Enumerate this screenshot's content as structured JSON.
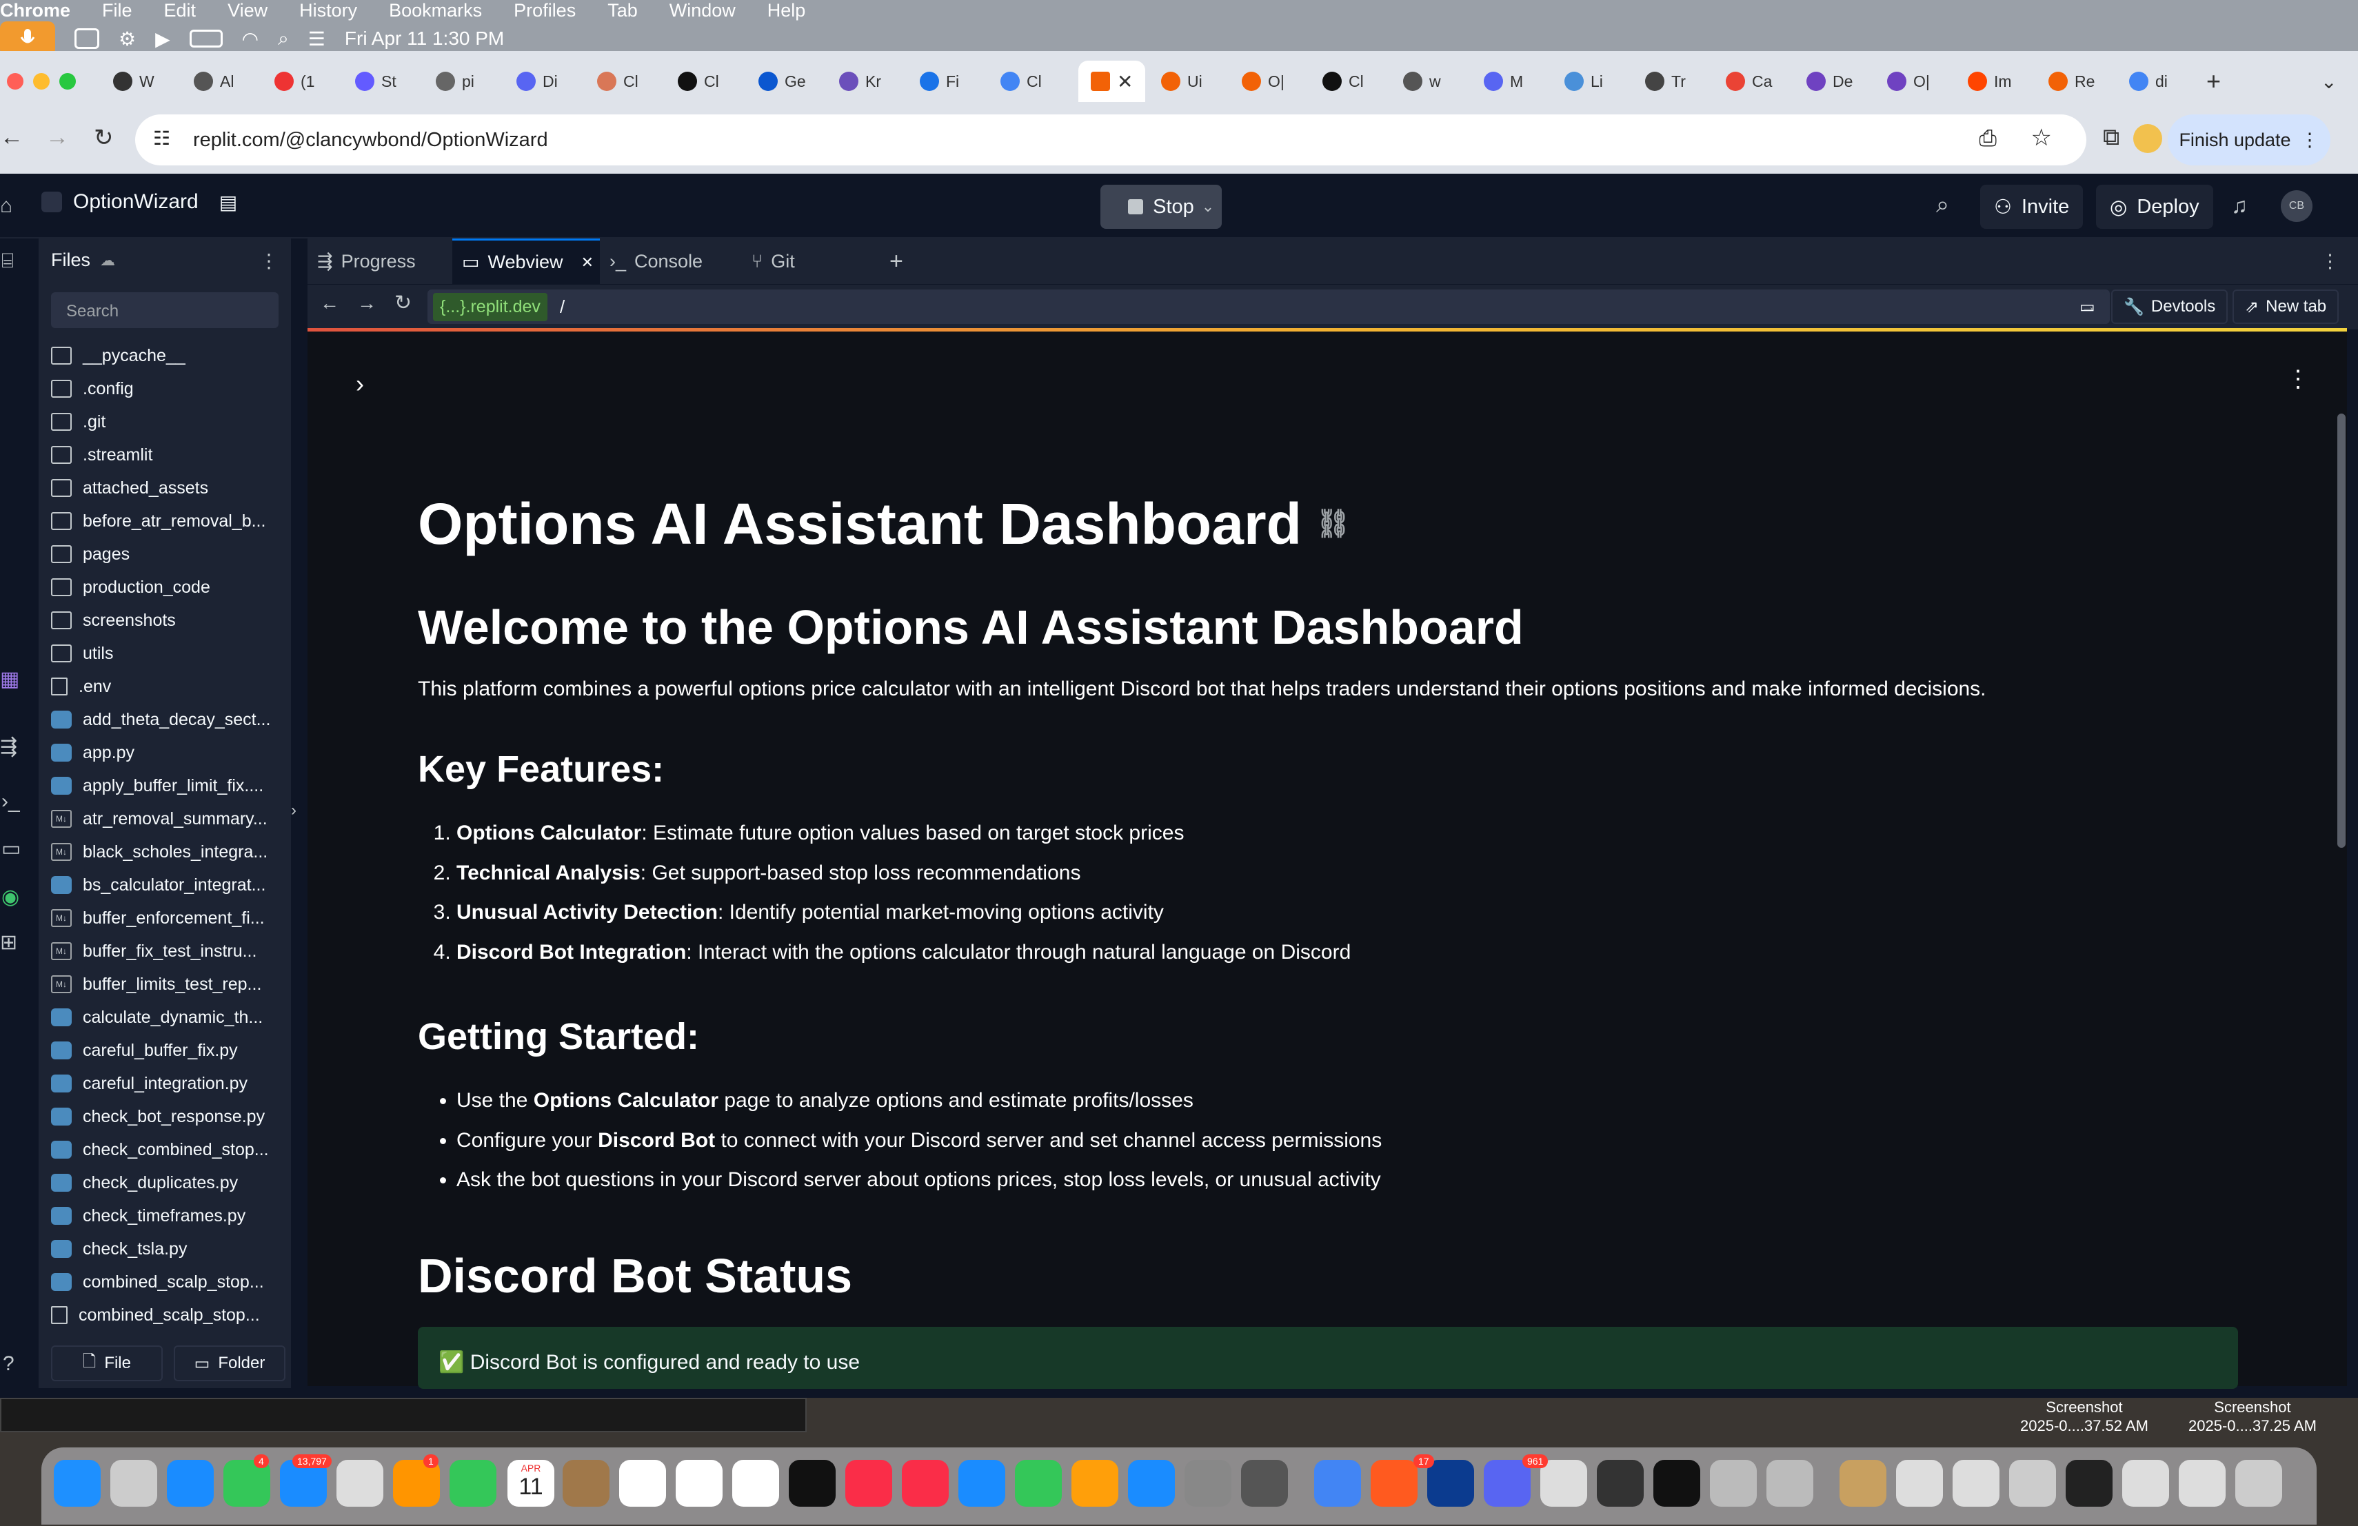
{
  "menubar": {
    "app_name": "Chrome",
    "menus": [
      "File",
      "Edit",
      "View",
      "History",
      "Bookmarks",
      "Profiles",
      "Tab",
      "Window",
      "Help"
    ],
    "datetime": "Fri Apr 11  1:30 PM"
  },
  "browser": {
    "tabs": [
      "W",
      "Al",
      "(1",
      "St",
      "pi",
      "Di",
      "Cl",
      "Cl",
      "Ge",
      "Kr",
      "Fi",
      "Cl",
      "",
      "Ui",
      "O|",
      "Cl",
      "w",
      "M",
      "Li",
      "Tr",
      "Ca",
      "De",
      "O|",
      "Im",
      "Re",
      "di"
    ],
    "url": "replit.com/@clancywbond/OptionWizard",
    "finish_update": "Finish update"
  },
  "replit": {
    "project_name": "OptionWizard",
    "stop_label": "Stop",
    "invite_label": "Invite",
    "deploy_label": "Deploy",
    "avatar": "CB",
    "files_title": "Files",
    "search_placeholder": "Search",
    "files": [
      {
        "name": "__pycache__",
        "type": "folder"
      },
      {
        "name": ".config",
        "type": "folder"
      },
      {
        "name": ".git",
        "type": "folder"
      },
      {
        "name": ".streamlit",
        "type": "folder"
      },
      {
        "name": "attached_assets",
        "type": "folder"
      },
      {
        "name": "before_atr_removal_b...",
        "type": "folder"
      },
      {
        "name": "pages",
        "type": "folder"
      },
      {
        "name": "production_code",
        "type": "folder"
      },
      {
        "name": "screenshots",
        "type": "folder"
      },
      {
        "name": "utils",
        "type": "folder"
      },
      {
        "name": ".env",
        "type": "doc"
      },
      {
        "name": "add_theta_decay_sect...",
        "type": "py"
      },
      {
        "name": "app.py",
        "type": "py"
      },
      {
        "name": "apply_buffer_limit_fix....",
        "type": "py"
      },
      {
        "name": "atr_removal_summary...",
        "type": "md"
      },
      {
        "name": "black_scholes_integra...",
        "type": "md"
      },
      {
        "name": "bs_calculator_integrat...",
        "type": "py"
      },
      {
        "name": "buffer_enforcement_fi...",
        "type": "md"
      },
      {
        "name": "buffer_fix_test_instru...",
        "type": "md"
      },
      {
        "name": "buffer_limits_test_rep...",
        "type": "md"
      },
      {
        "name": "calculate_dynamic_th...",
        "type": "py"
      },
      {
        "name": "careful_buffer_fix.py",
        "type": "py"
      },
      {
        "name": "careful_integration.py",
        "type": "py"
      },
      {
        "name": "check_bot_response.py",
        "type": "py"
      },
      {
        "name": "check_combined_stop...",
        "type": "py"
      },
      {
        "name": "check_duplicates.py",
        "type": "py"
      },
      {
        "name": "check_timeframes.py",
        "type": "py"
      },
      {
        "name": "check_tsla.py",
        "type": "py"
      },
      {
        "name": "combined_scalp_stop...",
        "type": "py"
      },
      {
        "name": "combined_scalp_stop...",
        "type": "doc"
      }
    ],
    "file_btn": "File",
    "folder_btn": "Folder",
    "pane_tabs": {
      "progress": "Progress",
      "webview": "Webview",
      "console": "Console",
      "git": "Git"
    },
    "webview_url_domain": "{...}.replit.dev",
    "webview_path": "/",
    "devtools": "Devtools",
    "new_tab": "New tab"
  },
  "page": {
    "title": "Options AI Assistant Dashboard",
    "welcome": "Welcome to the Options AI Assistant Dashboard",
    "intro": "This platform combines a powerful options price calculator with an intelligent Discord bot that helps traders understand their options positions and make informed decisions.",
    "features_heading": "Key Features:",
    "features": [
      {
        "bold": "Options Calculator",
        "text": ": Estimate future option values based on target stock prices"
      },
      {
        "bold": "Technical Analysis",
        "text": ": Get support-based stop loss recommendations"
      },
      {
        "bold": "Unusual Activity Detection",
        "text": ": Identify potential market-moving options activity"
      },
      {
        "bold": "Discord Bot Integration",
        "text": ": Interact with the options calculator through natural language on Discord"
      }
    ],
    "getting_started_heading": "Getting Started:",
    "getting_started": [
      {
        "pre": "Use the ",
        "bold": "Options Calculator",
        "post": " page to analyze options and estimate profits/losses"
      },
      {
        "pre": "Configure your ",
        "bold": "Discord Bot",
        "post": " to connect with your Discord server and set channel access permissions"
      },
      {
        "pre": "Ask the bot questions in your Discord server about options prices, stop loss levels, or unusual activity",
        "bold": "",
        "post": ""
      }
    ],
    "status_heading": "Discord Bot Status",
    "status_message": "✅ Discord Bot is configured and ready to use"
  },
  "desktop": {
    "screenshot1_title": "Screenshot",
    "screenshot1_time": "2025-0....37.52 AM",
    "screenshot2_title": "Screenshot",
    "screenshot2_time": "2025-0....37.25 AM",
    "dock_badges": {
      "messages": "4",
      "mail": "13,797",
      "photos": "1",
      "calendar_month": "APR",
      "calendar_day": "11",
      "discord": "961",
      "claude": "17"
    }
  }
}
